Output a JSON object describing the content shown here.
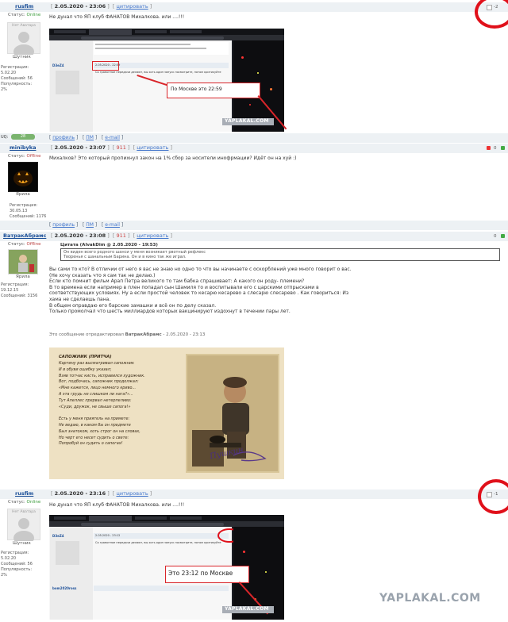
{
  "posts": [
    {
      "username": "rusfim",
      "date": "2.05.2020 - 23:06",
      "quote_link": "цитировать",
      "status_label": "Статус:",
      "status": "Online",
      "avatar_caption": "Нет Аватара",
      "rank": "Шутник",
      "reg_label": "Регистрация:",
      "reg_date": "5.02.20",
      "msgs_label": "Сообщений:",
      "msgs": "56",
      "births_label": "Популярность:",
      "births": "2%",
      "text": "Не дунал что ЯП клуб ФАНАТОВ Михалкова. или ....!!!",
      "rating": "-2",
      "annotation": "По Москве это 22:59",
      "watermark": "YAPLAKAL.COM",
      "shot_date": "2.05.2020 - 22:59",
      "shot_user": "D3eZ4",
      "shot_text": "Со грамотное передачи делают, вы хоть один запуск посмотрите, потом критикуйте"
    },
    {
      "username": "minibyka",
      "date": "2.05.2020 - 23:07",
      "num": "911",
      "quote_link": "цитировать",
      "status_label": "Статус:",
      "status": "Offline",
      "rank": "Ярила",
      "reg_label": "Регистрация:",
      "reg_date": "30.05.13",
      "msgs_label": "Сообщений:",
      "msgs": "1176",
      "text": "Михалков? Это который пропихнул закон на 1% сбор за носители инофрмации? Идёт он на хуй :)",
      "rating": "0"
    },
    {
      "username": "ВатракАбрамс",
      "date": "2.05.2020 - 23:08",
      "num": "911",
      "quote_link": "цитировать",
      "status_label": "Статус:",
      "status": "Offline",
      "rank": "Ярила",
      "reg_label": "Регистрация:",
      "reg_date": "19.12.15",
      "msgs_label": "Сообщений:",
      "msgs": "3156",
      "quote_header": "Цитата (AlvakDim @ 2.05.2020 - 19:53)",
      "quote_line1": "Он виден всего родного шанси у меня возникает рвотный рефлекс",
      "quote_line2": "Творенья с шанальным Барина. Он и в кино так же играл.",
      "body": [
        "Вы сами то кто? В отличии от него я вас не знаю но одно то что вы начинаете с оскорблений уже много говорит о вас.",
        "(Не хочу сказать что я сам так не делаю.)",
        "Если кто помнит фильм Арап Петра великого то там бабка спрашивает: А какого он роду- племени?",
        "В то времена если например в плен попадал сын Шамиля то и воспитывали его с царскими отпрысками в",
        "соответствующих условиях. Ну а если простой человек то кесарю кесарево а слесарю слесарево . Как говориться: Из",
        "хама не сделаешь пана.",
        "В общем оправдаю его барские замашки и всё он по делу сказал.",
        "Только промолчал что шесть миллиардов которых вакцинируют издохнут в течении пары лет."
      ],
      "edit_note_prefix": "Это сообщение отредактировал",
      "edit_note_user": "ВатракАбрамс",
      "edit_note_date": "- 2.05.2020 - 23:13",
      "rating": "0",
      "poem_title": "САПОЖНИК (ПРИТЧА)",
      "poem": [
        "Картину раз высматривал сапожник",
        "И в обуви ошибку указал;",
        "Взяв тотчас кисть, исправился художник.",
        "Вот, подбочась, сапожник продолжал:",
        "«Мне кажется, лицо немного криво...",
        "А эта грудь не слишком ли нага?»...",
        "Тут Апеллес прервал нетерпеливо:",
        "«Суди, дружок, не свыше сапога!»",
        "",
        "Есть у меня приятель на примете:",
        "Не ведаю, в каком бы он предмете",
        "Был знатоком, хоть строг он на словах,",
        "Но черт его несет судить о свете:",
        "Попробуй он судить о сапогах!"
      ],
      "signature": "Пушкин"
    },
    {
      "username": "rusfim",
      "date": "2.05.2020 - 23:16",
      "quote_link": "цитировать",
      "status_label": "Статус:",
      "status": "Online",
      "avatar_caption": "Нет Аватара",
      "rank": "Шутник",
      "reg_label": "Регистрация:",
      "reg_date": "5.02.20",
      "msgs_label": "Сообщений:",
      "msgs": "56",
      "births_label": "Популярность:",
      "births": "2%",
      "text": "Не дунал что ЯП клуб ФАНАТОВ Михалкова. или ....!!!",
      "rating": "-1",
      "annotation": "Это 23:12 по Москве",
      "shot_date": "2.05.2020 - 23:12",
      "shot_user": "D3eZ4",
      "shot_user2": "bom2020ross",
      "shot_text": "Со грамотное передачи делают, вы хоть один запуск посмотрите, потом критикуйте"
    }
  ],
  "footer_links": {
    "profile": "профиль",
    "pm": "ПМ",
    "email": "e-mail"
  },
  "uq_label": "UQ:",
  "uq_value": "28",
  "site_watermark": "YAPLAKAL.COM"
}
